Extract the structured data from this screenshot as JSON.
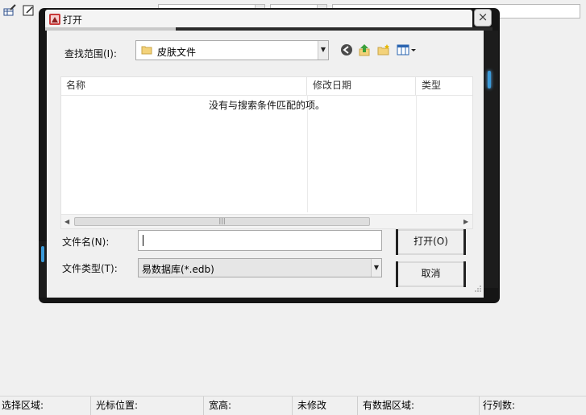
{
  "dialog": {
    "title": "打开",
    "close_glyph": "×",
    "look_in_label": "查找范围(I):",
    "look_in_value": "皮肤文件",
    "columns": [
      "名称",
      "修改日期",
      "类型"
    ],
    "empty_message": "没有与搜索条件匹配的项。",
    "filename_label": "文件名(N):",
    "filename_value": "",
    "filetype_label": "文件类型(T):",
    "filetype_value": "易数据库(*.edb)",
    "open_button": "打开(O)",
    "cancel_button": "取消",
    "hscroll_grip": "|||"
  },
  "statusbar": {
    "selection": "选择区域:",
    "cursor": "光标位置:",
    "size": "宽高:",
    "modified": "未修改",
    "data_region": "有数据区域:",
    "row_col_count": "行列数:"
  },
  "colors": {
    "frame": "#151515",
    "accent_light": "#3b9ad8",
    "back_icon": "#4a4a4a",
    "up_icon": "#3aa03a"
  },
  "icons": [
    "app-icon",
    "folder-icon",
    "back-icon",
    "up-folder-icon",
    "new-folder-icon",
    "view-menu-icon",
    "close-icon"
  ]
}
